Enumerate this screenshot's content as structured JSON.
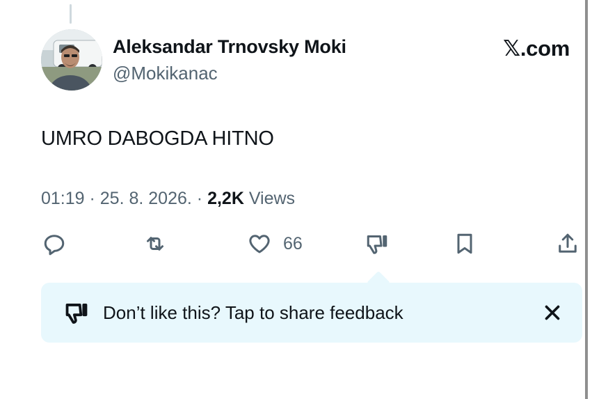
{
  "author": {
    "display_name": "Aleksandar Trnovsky Moki",
    "handle": "@Mokikanac",
    "avatar_icon": "profile-photo"
  },
  "brand": {
    "label": "𝕏.com"
  },
  "tweet": {
    "text": "UMRO DABOGDA HITNO",
    "time": "01:19",
    "separator_1": " · ",
    "date": "25. 8. 2026.",
    "separator_2": " · ",
    "views_count": "2,2K",
    "views_label": " Views"
  },
  "actions": {
    "reply_icon": "reply-icon",
    "retweet_icon": "retweet-icon",
    "like_icon": "heart-icon",
    "like_count": "66",
    "dislike_icon": "thumbs-down-icon",
    "bookmark_icon": "bookmark-icon",
    "share_icon": "share-icon"
  },
  "feedback_prompt": {
    "icon": "thumbs-down-icon",
    "text": "Don’t like this? Tap to share feedback",
    "close_icon": "close-icon",
    "background_color": "#e8f8fd"
  },
  "colors": {
    "text_primary": "#0f1419",
    "text_secondary": "#536471"
  }
}
